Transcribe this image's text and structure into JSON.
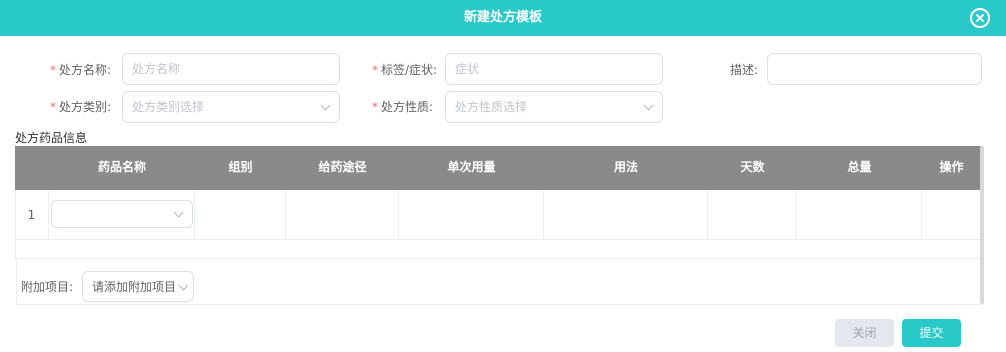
{
  "dialog": {
    "title": "新建处方模板",
    "close_icon": "close-circle-icon"
  },
  "form": {
    "name_label": "处方名称:",
    "name_placeholder": "处方名称",
    "tag_label": "标签/症状:",
    "tag_placeholder": "症状",
    "desc_label": "描述:",
    "desc_placeholder": "",
    "category_label": "处方类别:",
    "category_placeholder": "处方类别选择",
    "nature_label": "处方性质:",
    "nature_placeholder": "处方性质选择",
    "required_mark": "*"
  },
  "drug_section": {
    "title": "处方药品信息",
    "columns": [
      "药品名称",
      "组别",
      "给药途径",
      "单次用量",
      "用法",
      "天数",
      "总量",
      "操作"
    ],
    "rows": [
      {
        "no": "1",
        "drug_name": ""
      }
    ]
  },
  "addon": {
    "label": "附加项目:",
    "placeholder": "请添加附加项目"
  },
  "footer": {
    "close_label": "关闭",
    "submit_label": "提交"
  },
  "colors": {
    "accent": "#2ac9c9",
    "table_header": "#8a8a8a",
    "required": "#f56c6c"
  }
}
